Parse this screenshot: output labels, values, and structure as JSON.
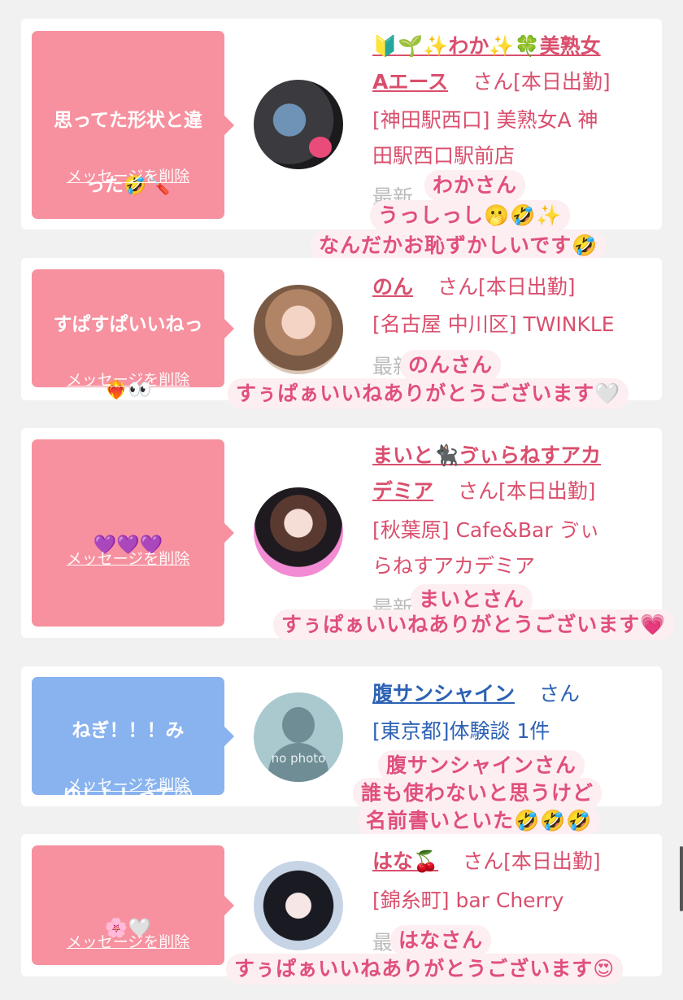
{
  "items": [
    {
      "theme": "pink",
      "message_line1": "思ってた形状と違",
      "message_line2": "った🤣🪛",
      "delete_label": "メッセージを削除",
      "name_line1": "🔰🌱✨わか✨🍀美熟女",
      "name_line2": "Aエース",
      "honorific": "さん[本日出勤]",
      "shop_line1": "[神田駅西口] 美熟女A 神",
      "shop_line2": "田駅西口駅前店",
      "hidden_text": "最新",
      "caption_lines": [
        "わかさん",
        "うっしっし🫢🤣✨",
        "なんだかお恥ずかしいです🤣"
      ]
    },
    {
      "theme": "pink",
      "message_line1": "すぱすぱいいねっ",
      "message_line2": "❤️‍🔥👀",
      "delete_label": "メッセージを削除",
      "name_line1": "のん",
      "honorific": "さん[本日出勤]",
      "shop_line1": "[名古屋 中川区] TWINKLE",
      "hidden_text": "最新 を見る",
      "caption_lines": [
        "のんさん",
        "すぅぱぁいいねありがとうございます🤍"
      ]
    },
    {
      "theme": "pink",
      "message_line1": "💜💜💜",
      "delete_label": "メッセージを削除",
      "name_line1": "まいと🐈‍⬛ゔぃらねすアカ",
      "name_line2": "デミア",
      "honorific": "さん[本日出勤]",
      "shop_line1": "[秋葉原] Cafe&Bar ゔぃ",
      "shop_line2": "らねすアカデミア",
      "hidden_text": "最新 る",
      "caption_lines": [
        "まいとさん",
        "すぅぱぁいいねありがとうございます💗"
      ]
    },
    {
      "theme": "blue",
      "message_line1": "ねぎ！！！み",
      "message_line2": "ゆ！！！って😆",
      "delete_label": "メッセージを削除",
      "name_line1": "腹サンシャイン",
      "honorific": "さん",
      "shop_line1": "[東京都]体験談 1件",
      "avatar_text": "no photo",
      "caption_lines": [
        "腹サンシャインさん",
        "誰も使わないと思うけど",
        "名前書いといた🤣🤣🤣"
      ]
    },
    {
      "theme": "pink",
      "message_line1": "🌸🤍",
      "delete_label": "メッセージを削除",
      "name_line1": "はな🍒",
      "honorific": "さん[本日出勤]",
      "shop_line1": "[錦糸町] bar Cherry",
      "hidden_text": "最 を見る",
      "caption_lines": [
        "はなさん",
        "すぅぱぁいいねありがとうございます😍"
      ]
    }
  ]
}
